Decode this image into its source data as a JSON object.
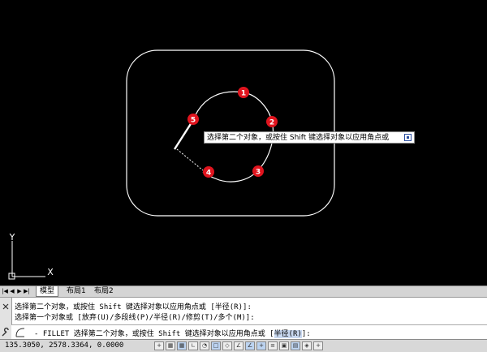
{
  "markers": [
    "1",
    "2",
    "3",
    "4",
    "5"
  ],
  "tooltip": {
    "text": "选择第二个对象，或按住 Shift 键选择对象以应用角点或"
  },
  "ucs": {
    "x_label": "X",
    "y_label": "Y"
  },
  "tabs": [
    {
      "label": "模型",
      "active": true
    },
    {
      "label": "布局1",
      "active": false
    },
    {
      "label": "布局2",
      "active": false
    }
  ],
  "command": {
    "history": [
      "选择第二个对象，或按住 Shift 键选择对象以应用角点或 [半径(R)]:",
      "选择第一个对象或 [放弃(U)/多段线(P)/半径(R)/修剪(T)/多个(M)]:"
    ],
    "current_prefix": "- FILLET 选择第二个对象，或按住 Shift 键选择对象以应用角点或 [",
    "current_option": "半径(R)",
    "current_suffix": "]:"
  },
  "status": {
    "coordinates": "135.3050, 2578.3364, 0.0000"
  },
  "colors": {
    "canvas": "#000000",
    "geometry": "#ffffff",
    "marker": "#e0141e"
  }
}
